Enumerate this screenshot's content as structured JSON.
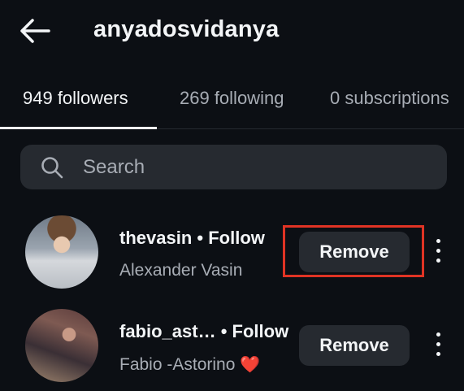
{
  "header": {
    "title": "anyadosvidanya",
    "back_icon": "arrow-left-icon"
  },
  "tabs": [
    {
      "label": "949 followers",
      "active": true
    },
    {
      "label": "269 following",
      "active": false
    },
    {
      "label": "0 subscriptions",
      "active": false
    }
  ],
  "search": {
    "placeholder": "Search",
    "icon": "search-icon"
  },
  "followers": [
    {
      "username": "thevasin",
      "separator": "•",
      "follow_label": "Follow",
      "full_name": "Alexander Vasin",
      "remove_label": "Remove",
      "highlighted": true
    },
    {
      "username": "fabio_ast…",
      "separator": "•",
      "follow_label": "Follow",
      "full_name": "Fabio -Astorino",
      "name_emoji": "❤️",
      "remove_label": "Remove",
      "highlighted": false
    }
  ],
  "colors": {
    "background": "#0c0f14",
    "button_bg": "#262a30",
    "secondary_text": "#a8adb5",
    "highlight": "#e03324",
    "heart": "#e0272f"
  }
}
